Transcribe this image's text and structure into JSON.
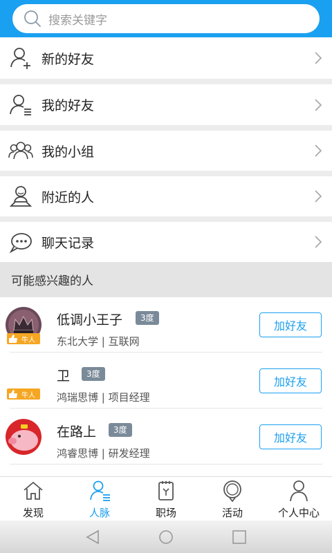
{
  "search": {
    "placeholder": "搜索关键字"
  },
  "menu": [
    {
      "label": "新的好友",
      "icon": "add-friend-icon"
    },
    {
      "label": "我的好友",
      "icon": "friend-list-icon"
    },
    {
      "label": "我的小组",
      "icon": "group-icon"
    },
    {
      "label": "附近的人",
      "icon": "nearby-person-icon"
    },
    {
      "label": "聊天记录",
      "icon": "chat-bubble-icon"
    }
  ],
  "suggest_header": "可能感兴趣的人",
  "people": [
    {
      "name": "低调小王子",
      "degree": "3度",
      "info": "东北大学 | 互联网",
      "badge": "牛人",
      "add_label": "加好友"
    },
    {
      "name": "卫",
      "degree": "3度",
      "info": "鸿瑞思博 | 项目经理",
      "badge": "牛人",
      "add_label": "加好友"
    },
    {
      "name": "在路上",
      "degree": "3度",
      "info": "鸿睿思博 | 研发经理",
      "badge": "",
      "add_label": "加好友"
    }
  ],
  "tabs": [
    {
      "label": "发现",
      "icon": "home-icon",
      "active": false
    },
    {
      "label": "人脉",
      "icon": "contacts-icon",
      "active": true
    },
    {
      "label": "职场",
      "icon": "workplace-icon",
      "active": false
    },
    {
      "label": "活动",
      "icon": "activity-icon",
      "active": false
    },
    {
      "label": "个人中心",
      "icon": "profile-icon",
      "active": false
    }
  ],
  "colors": {
    "accent": "#1aa0f0",
    "degree_badge": "#7a8a99"
  }
}
